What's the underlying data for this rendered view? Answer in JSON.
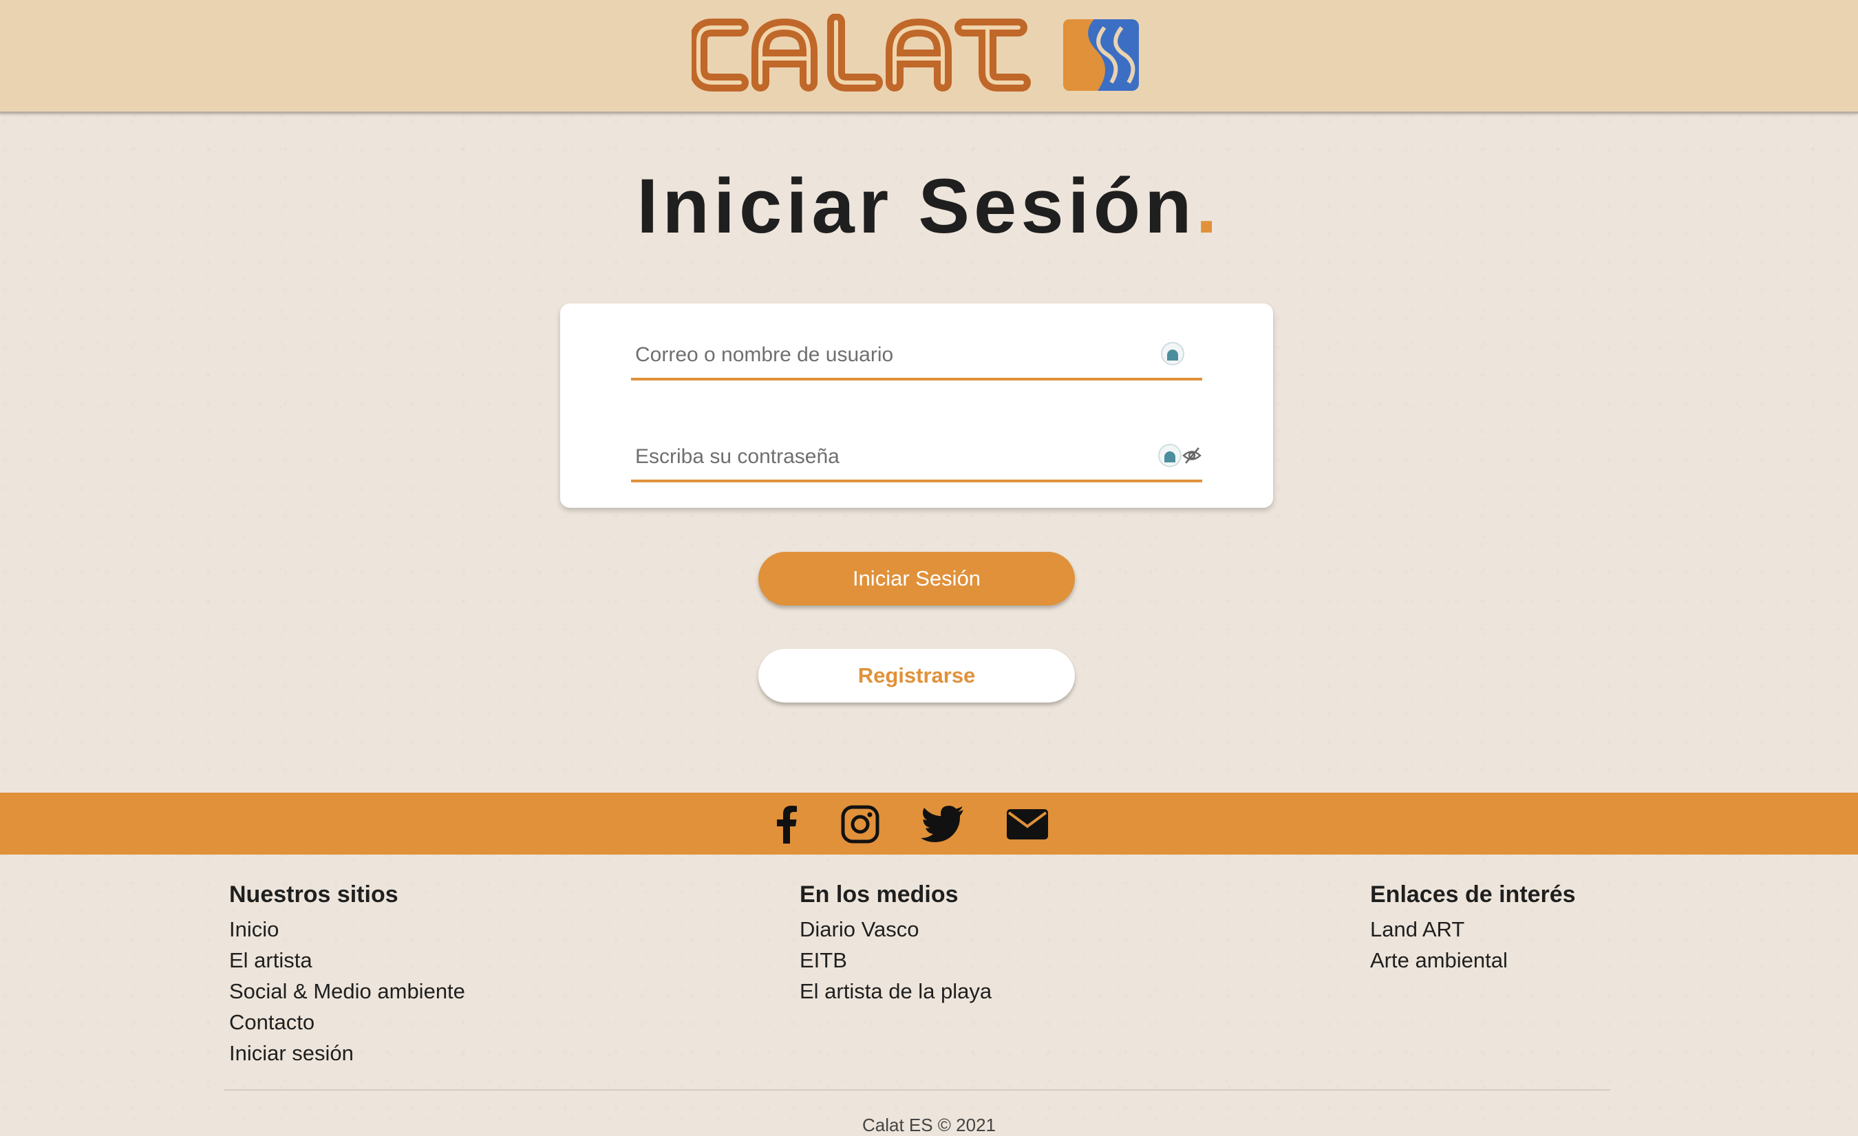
{
  "header": {
    "logo_text": "CALAT",
    "logo_colors": {
      "orange": "#c0672a",
      "blue": "#3c6fc4",
      "cream": "#f0d6ad"
    }
  },
  "page": {
    "title": "Iniciar Sesión",
    "title_dot": ".",
    "accent_color": "#e0913a"
  },
  "login_form": {
    "username_placeholder": "Correo o nombre de usuario",
    "username_value": "",
    "password_placeholder": "Escriba su contraseña",
    "password_value": "",
    "login_button": "Iniciar Sesión",
    "register_button": "Registrarse"
  },
  "social": {
    "icons": [
      "facebook-icon",
      "instagram-icon",
      "twitter-icon",
      "mail-icon"
    ]
  },
  "footer": {
    "columns": [
      {
        "heading": "Nuestros sitios",
        "links": [
          "Inicio",
          "El artista",
          "Social & Medio ambiente",
          "Contacto",
          "Iniciar sesión"
        ]
      },
      {
        "heading": "En los medios",
        "links": [
          "Diario Vasco",
          "EITB",
          "El artista de la playa"
        ]
      },
      {
        "heading": "Enlaces de interés",
        "links": [
          "Land ART",
          "Arte ambiental"
        ]
      }
    ],
    "copyright": "Calat ES © 2021"
  }
}
